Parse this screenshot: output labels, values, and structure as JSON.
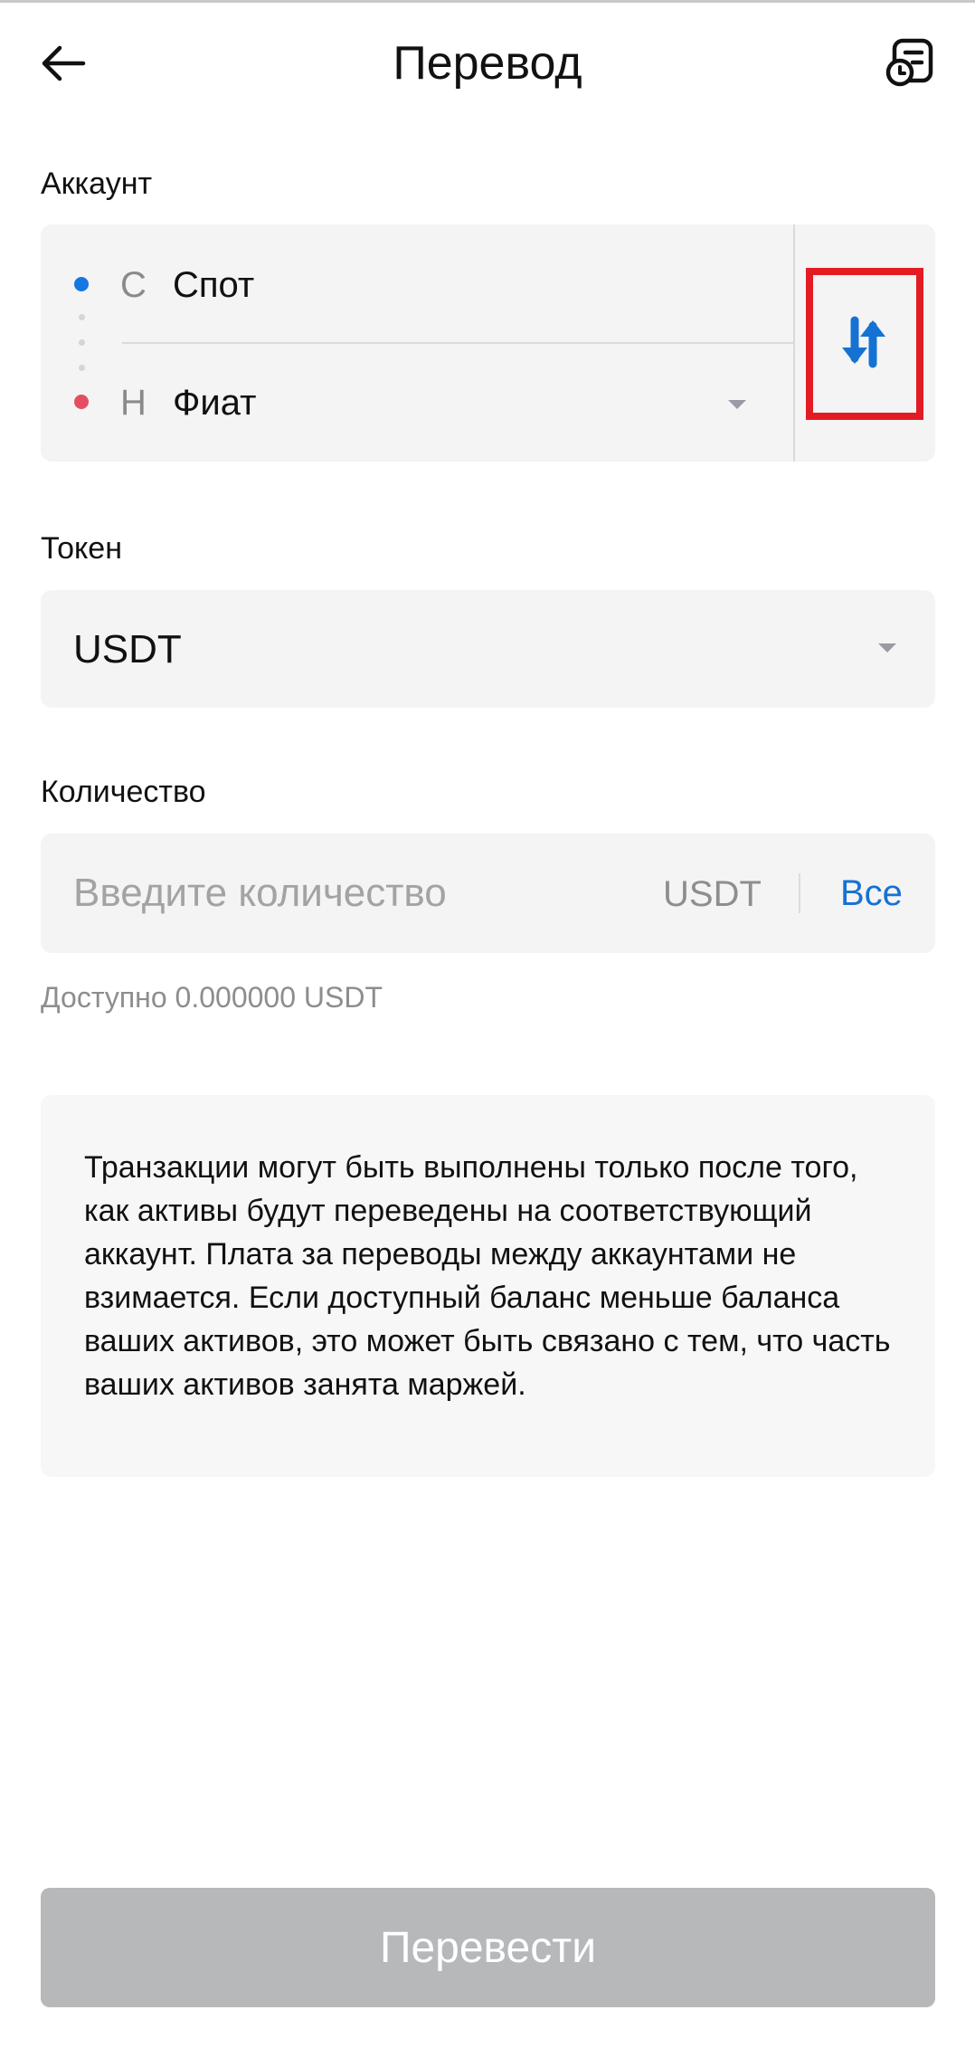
{
  "header": {
    "title": "Перевод",
    "back_icon": "arrow-left-icon",
    "history_icon": "transfer-history-icon"
  },
  "account": {
    "label": "Аккаунт",
    "from": {
      "prefix": "С",
      "name": "Спот",
      "dot_color": "#1677e0"
    },
    "to": {
      "prefix": "Н",
      "name": "Фиат",
      "dot_color": "#e44e62"
    },
    "swap_icon": "swap-arrows-icon",
    "swap_color": "#1572d3",
    "highlight_color": "#e31b23"
  },
  "token": {
    "label": "Токен",
    "value": "USDT"
  },
  "amount": {
    "label": "Количество",
    "placeholder": "Введите количество",
    "unit": "USDT",
    "all_label": "Все",
    "available_text": "Доступно 0.000000 USDT"
  },
  "notice": {
    "text": "Транзакции могут быть выполнены только после того, как активы будут переведены на соответствующий аккаунт. Плата за переводы между аккаунтами не взимается. Если доступный баланс меньше баланса ваших активов, это может быть связано с тем, что часть ваших активов занята маржей."
  },
  "submit": {
    "label": "Перевести"
  }
}
